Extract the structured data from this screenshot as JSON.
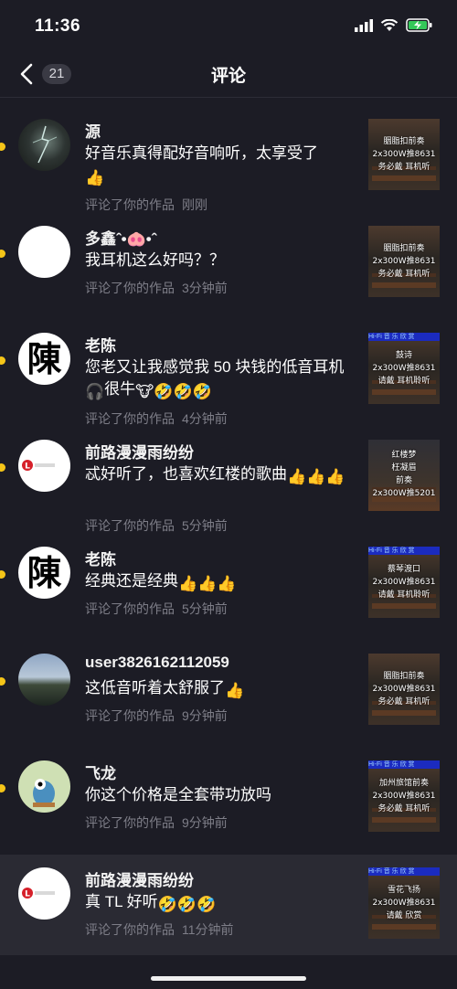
{
  "status": {
    "time": "11:36"
  },
  "nav": {
    "back_count": "21",
    "title": "评论"
  },
  "comments": [
    {
      "name": "源",
      "text": "好音乐真得配好音响听，太享受了",
      "action": "评论了你的作品",
      "ago": "刚刚",
      "thumb": "胭脂扣前奏\n2x300W推8631\n务必戴  耳机听"
    },
    {
      "name": "多鑫ˆ•🐽•ˆ",
      "text": "我耳机这么好吗？？",
      "action": "评论了你的作品",
      "ago": "3分钟前",
      "thumb": "胭脂扣前奏\n2x300W推8631\n务必戴  耳机听"
    },
    {
      "name": "老陈",
      "text": "您老又让我感觉我 50 块钱的低音耳机",
      "text2": "很牛",
      "action": "评论了你的作品",
      "ago": "4分钟前",
      "thumb": "鼓诗\n2x300W推8631\n请戴  耳机聆听",
      "band": "Hi-Fi 音 乐 欣 赏"
    },
    {
      "name": "前路漫漫雨纷纷",
      "text": "忒好听了，也喜欢红楼的歌曲",
      "action": "评论了你的作品",
      "ago": "5分钟前",
      "thumb": "红楼梦\n枉凝眉\n前奏\n2x300W推5201"
    },
    {
      "name": "老陈",
      "text": "经典还是经典",
      "action": "评论了你的作品",
      "ago": "5分钟前",
      "thumb": "蔡琴渡口\n2x300W推8631\n请戴  耳机聆听",
      "band": "Hi-Fi 音 乐 欣 赏"
    },
    {
      "name": "user3826162112059",
      "text": "这低音听着太舒服了",
      "action": "评论了你的作品",
      "ago": "9分钟前",
      "thumb": "胭脂扣前奏\n2x300W推8631\n务必戴  耳机听"
    },
    {
      "name": "飞龙",
      "text": "你这个价格是全套带功放吗",
      "action": "评论了你的作品",
      "ago": "9分钟前",
      "thumb": "加州旅馆前奏\n2x300W推8631\n务必戴  耳机听",
      "band": "Hi-Fi 音 乐 欣 赏"
    },
    {
      "name": "前路漫漫雨纷纷",
      "text": "真 TL 好听",
      "action": "评论了你的作品",
      "ago": "11分钟前",
      "thumb": "雪花飞扬\n2x300W推8631\n请戴  欣赏",
      "band": "Hi-Fi 音 乐 欣 赏"
    }
  ],
  "colors": {
    "background": "#1c1c25",
    "unread_dot": "#f5c518",
    "meta_text": "#7e7e88"
  },
  "icons": [
    "back-arrow-icon",
    "signal-icon",
    "wifi-icon",
    "battery-charging-icon",
    "thumbs-up-icon",
    "headphones-icon",
    "cow-icon",
    "rofl-icon"
  ]
}
